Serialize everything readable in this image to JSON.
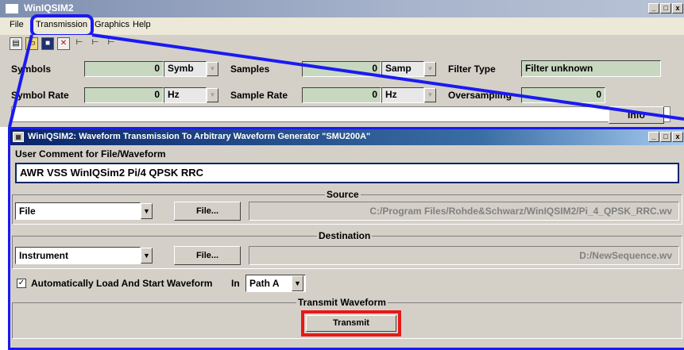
{
  "main_window": {
    "title": "WinIQSIM2",
    "caption_buttons": [
      "_",
      "□",
      "x"
    ]
  },
  "menu": {
    "items": [
      "File",
      "Transmission",
      "Graphics",
      "Help"
    ]
  },
  "toolbar": {
    "icons": [
      "new-file-icon",
      "open-folder-icon",
      "save-icon",
      "delete-icon",
      "marker-1-icon",
      "marker-2-icon",
      "marker-3-icon"
    ]
  },
  "params": {
    "symbols_label": "Symbols",
    "symbols_value": "0",
    "symbols_unit": "Symb",
    "samples_label": "Samples",
    "samples_value": "0",
    "samples_unit": "Samp",
    "filter_type_label": "Filter Type",
    "filter_type_value": "Filter unknown",
    "symbol_rate_label": "Symbol Rate",
    "symbol_rate_value": "0",
    "symbol_rate_unit": "Hz",
    "sample_rate_label": "Sample Rate",
    "sample_rate_value": "0",
    "sample_rate_unit": "Hz",
    "oversampling_label": "Oversampling",
    "oversampling_value": "0",
    "info_label": "Info"
  },
  "dialog": {
    "title": "WinIQSIM2: Waveform Transmission To Arbitrary Waveform Generator \"SMU200A\"",
    "comment_label": "User Comment for File/Waveform",
    "comment_value": "AWR VSS WinIQSim2 Pi/4 QPSK RRC",
    "source": {
      "title": "Source",
      "type": "File",
      "button": "File...",
      "path": "C:/Program Files/Rohde&Schwarz/WinIQSIM2/Pi_4_QPSK_RRC.wv"
    },
    "destination": {
      "title": "Destination",
      "type": "Instrument",
      "button": "File...",
      "path": "D:/NewSequence.wv"
    },
    "autoload_label": "Automatically Load And Start Waveform",
    "autoload_checked": true,
    "in_label": "In",
    "path_value": "Path A",
    "transmit_group_title": "Transmit Waveform",
    "transmit_button": "Transmit"
  },
  "colors": {
    "highlight_blue": "#1a1af0",
    "highlight_red": "#e81818"
  }
}
